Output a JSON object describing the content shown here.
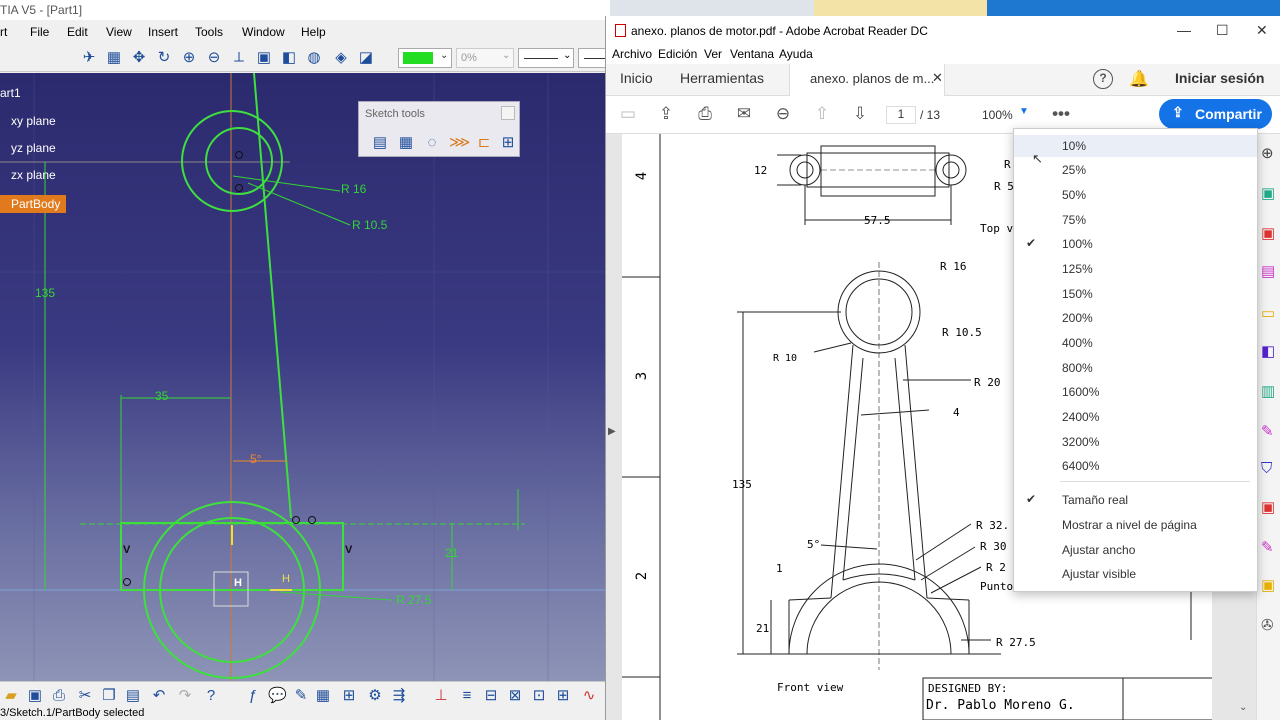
{
  "catia": {
    "title": "TIA V5 - [Part1]",
    "menu": [
      "rt",
      "File",
      "Edit",
      "View",
      "Insert",
      "Tools",
      "Window",
      "Help"
    ],
    "color_swatch": "#22dd22",
    "transparency": "0%",
    "tree": {
      "root": "art1",
      "items": [
        "xy plane",
        "yz plane",
        "zx plane"
      ],
      "partbody": "PartBody"
    },
    "sketch_tools_title": "Sketch tools",
    "dimensions": {
      "r16": "R 16",
      "r105": "R 10.5",
      "d135": "135",
      "d35": "35",
      "angle": "5°",
      "d21": "21",
      "r275": "R 27.5",
      "v": "V",
      "h": "H"
    },
    "status": "3/Sketch.1/PartBody selected"
  },
  "acrobat": {
    "title": "anexo. planos de motor.pdf - Adobe Acrobat Reader DC",
    "menu": [
      "Archivo",
      "Edición",
      "Ver",
      "Ventana",
      "Ayuda"
    ],
    "tabs": {
      "home": "Inicio",
      "tools": "Herramientas",
      "doc": "anexo. planos de m...",
      "signin": "Iniciar sesión"
    },
    "page_current": "1",
    "page_total": "/ 13",
    "zoom": "100%",
    "share": "Compartir",
    "drawing": {
      "row_labels": [
        "4",
        "3",
        "2"
      ],
      "d12": "12",
      "d575": "57.5",
      "top_view": "Top v",
      "r5": "R 5",
      "r": "R",
      "r16": "R 16",
      "r105": "R 10.5",
      "r10": "R 10",
      "r20": "R 20",
      "d4": "4",
      "d135": "135",
      "r32": "R 32.",
      "r30": "R 30",
      "r2": "R 2",
      "angle5": "5°",
      "d1": "1",
      "d21": "21",
      "punto": "Punto",
      "r275": "R 27.5",
      "front_view": "Front view",
      "designed_by": "DESIGNED BY:",
      "designer": "Dr. Pablo Moreno G."
    },
    "zoom_menu": {
      "levels": [
        "10%",
        "25%",
        "50%",
        "75%",
        "100%",
        "125%",
        "150%",
        "200%",
        "400%",
        "800%",
        "1600%",
        "2400%",
        "3200%",
        "6400%"
      ],
      "selected": "100%",
      "fit_options": [
        "Tamaño real",
        "Mostrar a nivel de página",
        "Ajustar ancho",
        "Ajustar visible"
      ],
      "fit_selected": "Tamaño real"
    }
  },
  "colors": {
    "sketch_green": "#3ee03e",
    "dim_green": "#33d633",
    "acrobat_blue": "#1473e6",
    "partbody_orange": "#e07a1c"
  }
}
